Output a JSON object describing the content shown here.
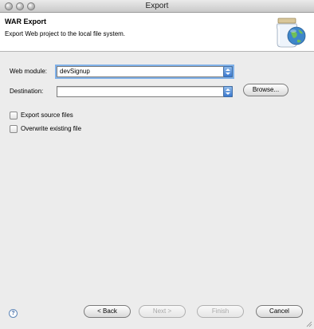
{
  "window": {
    "title": "Export"
  },
  "banner": {
    "title": "WAR Export",
    "description": "Export Web project to the local file system."
  },
  "form": {
    "web_module_label": "Web module:",
    "web_module_value": "devSignup",
    "destination_label": "Destination:",
    "destination_value": "",
    "browse_label": "Browse...",
    "export_source_label": "Export source files",
    "export_source_checked": false,
    "overwrite_label": "Overwrite existing file",
    "overwrite_checked": false
  },
  "footer": {
    "help_glyph": "?",
    "back_label": "< Back",
    "next_label": "Next >",
    "finish_label": "Finish",
    "cancel_label": "Cancel"
  },
  "colors": {
    "accent": "#3a79d0",
    "focus_ring": "#7fb0e8"
  }
}
